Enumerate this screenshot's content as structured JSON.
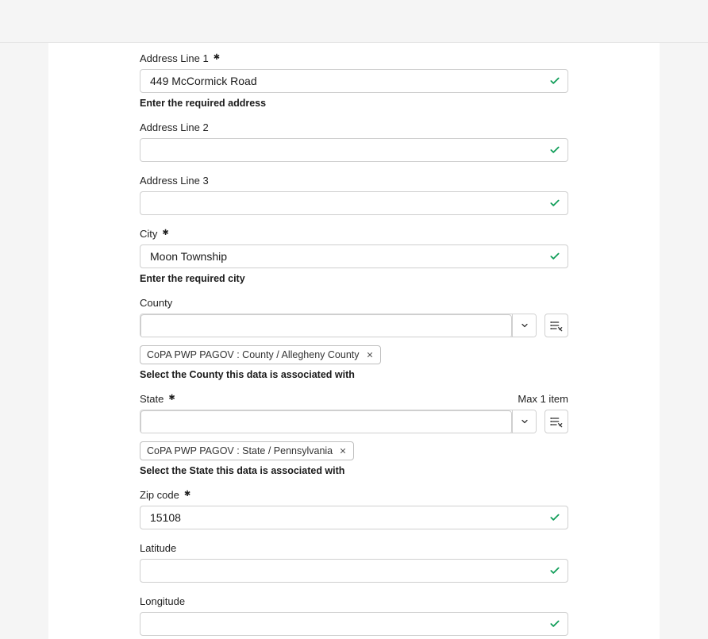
{
  "address1": {
    "label": "Address Line 1",
    "value": "449 McCormick Road",
    "help": "Enter the required address"
  },
  "address2": {
    "label": "Address Line 2",
    "value": ""
  },
  "address3": {
    "label": "Address Line 3",
    "value": ""
  },
  "city": {
    "label": "City",
    "value": "Moon Township",
    "help": "Enter the required city"
  },
  "county": {
    "label": "County",
    "value": "",
    "chip": "CoPA PWP PAGOV : County / Allegheny County",
    "help": "Select the County this data is associated with"
  },
  "state": {
    "label": "State",
    "maxNote": "Max 1 item",
    "value": "",
    "chip": "CoPA PWP PAGOV : State / Pennsylvania",
    "help": "Select the State this data is associated with"
  },
  "zip": {
    "label": "Zip code",
    "value": "15108"
  },
  "latitude": {
    "label": "Latitude",
    "value": ""
  },
  "longitude": {
    "label": "Longitude",
    "value": ""
  }
}
